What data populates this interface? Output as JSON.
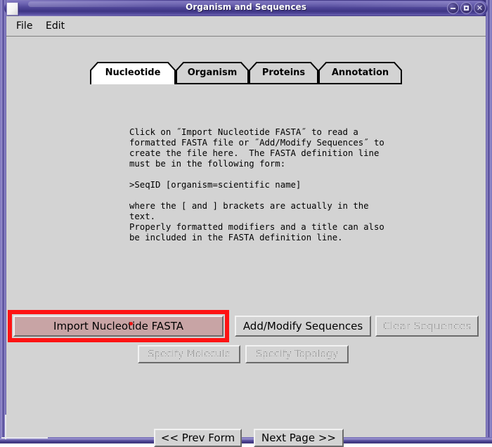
{
  "window": {
    "title": "Organism and Sequences",
    "icon": "document-icon",
    "controls": [
      {
        "name": "minimize-button",
        "glyph": "minimize-icon"
      },
      {
        "name": "maximize-button",
        "glyph": "maximize-icon"
      },
      {
        "name": "close-button",
        "glyph": "close-icon",
        "label": "✕"
      }
    ]
  },
  "menubar": {
    "items": [
      {
        "label": "File"
      },
      {
        "label": "Edit"
      }
    ]
  },
  "tabs": {
    "active_index": 0,
    "items": [
      {
        "label": "Nucleotide",
        "selected": true
      },
      {
        "label": "Organism",
        "selected": false
      },
      {
        "label": "Proteins",
        "selected": false
      },
      {
        "label": "Annotation",
        "selected": false
      }
    ]
  },
  "instructions": {
    "text": "Click on ˝Import Nucleotide FASTA˝ to read a\nformatted FASTA file or ˝Add/Modify Sequences˝ to\ncreate the file here.  The FASTA definition line\nmust be in the following form:\n\n>SeqID [organism=scientific name]\n\nwhere the [ and ] brackets are actually in the\ntext.\nProperly formatted modifiers and a title can also\nbe included in the FASTA definition line."
  },
  "actions": {
    "import_nucleotide_fasta": {
      "label": "Import Nucleotide FASTA",
      "state": "highlighted",
      "enabled": true
    },
    "add_modify_sequences": {
      "label": "Add/Modify Sequences",
      "state": "normal",
      "enabled": true
    },
    "clear_sequences": {
      "label": "Clear Sequences",
      "state": "disabled",
      "enabled": false
    },
    "specify_molecule": {
      "label": "Specify Molecule",
      "state": "disabled",
      "enabled": false
    },
    "specify_topology": {
      "label": "Specify Topology",
      "state": "disabled",
      "enabled": false
    }
  },
  "navigation": {
    "prev": {
      "label": "<< Prev Form"
    },
    "next": {
      "label": "Next Page >>"
    }
  },
  "colors": {
    "highlight_box": "#FE1313",
    "highlight_button_fill": "#C8A4A5",
    "window_face": "#D3D3D3",
    "titlebar_dark": "#3E3584",
    "titlebar_light": "#7D74BD",
    "tab_selected_fill": "#FFFFFF",
    "disabled_text": "#5A5A5A"
  }
}
